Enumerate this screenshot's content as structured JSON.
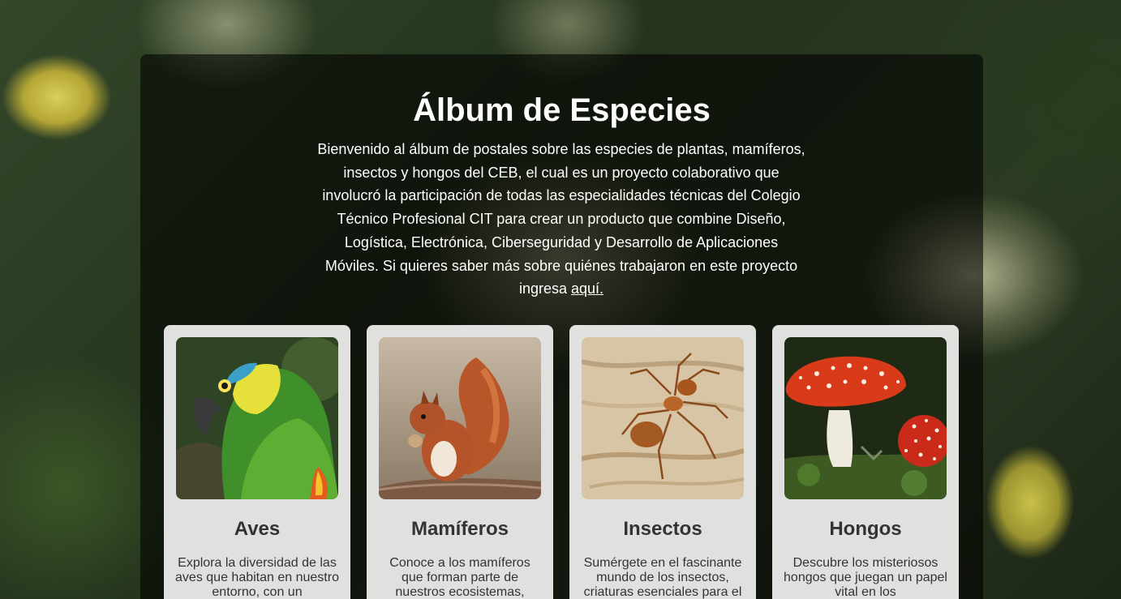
{
  "header": {
    "title": "Álbum de Especies",
    "intro_text": "Bienvenido al álbum de postales sobre las especies de plantas, mamíferos, insectos y hongos del CEB, el cual es un proyecto colaborativo que involucró la participación de todas las especialidades técnicas del Colegio Técnico Profesional CIT para crear un producto que combine Diseño, Logística, Electrónica, Ciberseguridad y Desarrollo de Aplicaciones Móviles. Si quieres saber más sobre quiénes trabajaron en este proyecto ingresa ",
    "link_label": "aquí."
  },
  "cards": [
    {
      "title": "Aves",
      "description": "Explora la diversidad de las aves que habitan en nuestro entorno, con un",
      "image_icon": "parrot-photo"
    },
    {
      "title": "Mamíferos",
      "description": "Conoce a los mamíferos que forman parte de nuestros ecosistemas,",
      "image_icon": "squirrel-photo"
    },
    {
      "title": "Insectos",
      "description": "Sumérgete en el fascinante mundo de los insectos, criaturas esenciales para el",
      "image_icon": "ant-photo"
    },
    {
      "title": "Hongos",
      "description": "Descubre los misteriosos hongos que juegan un papel vital en los",
      "image_icon": "mushroom-photo"
    }
  ],
  "colors": {
    "overlay": "#000000",
    "card_background": "#f0f0f0",
    "card_text": "#333333",
    "header_text": "#ffffff"
  }
}
